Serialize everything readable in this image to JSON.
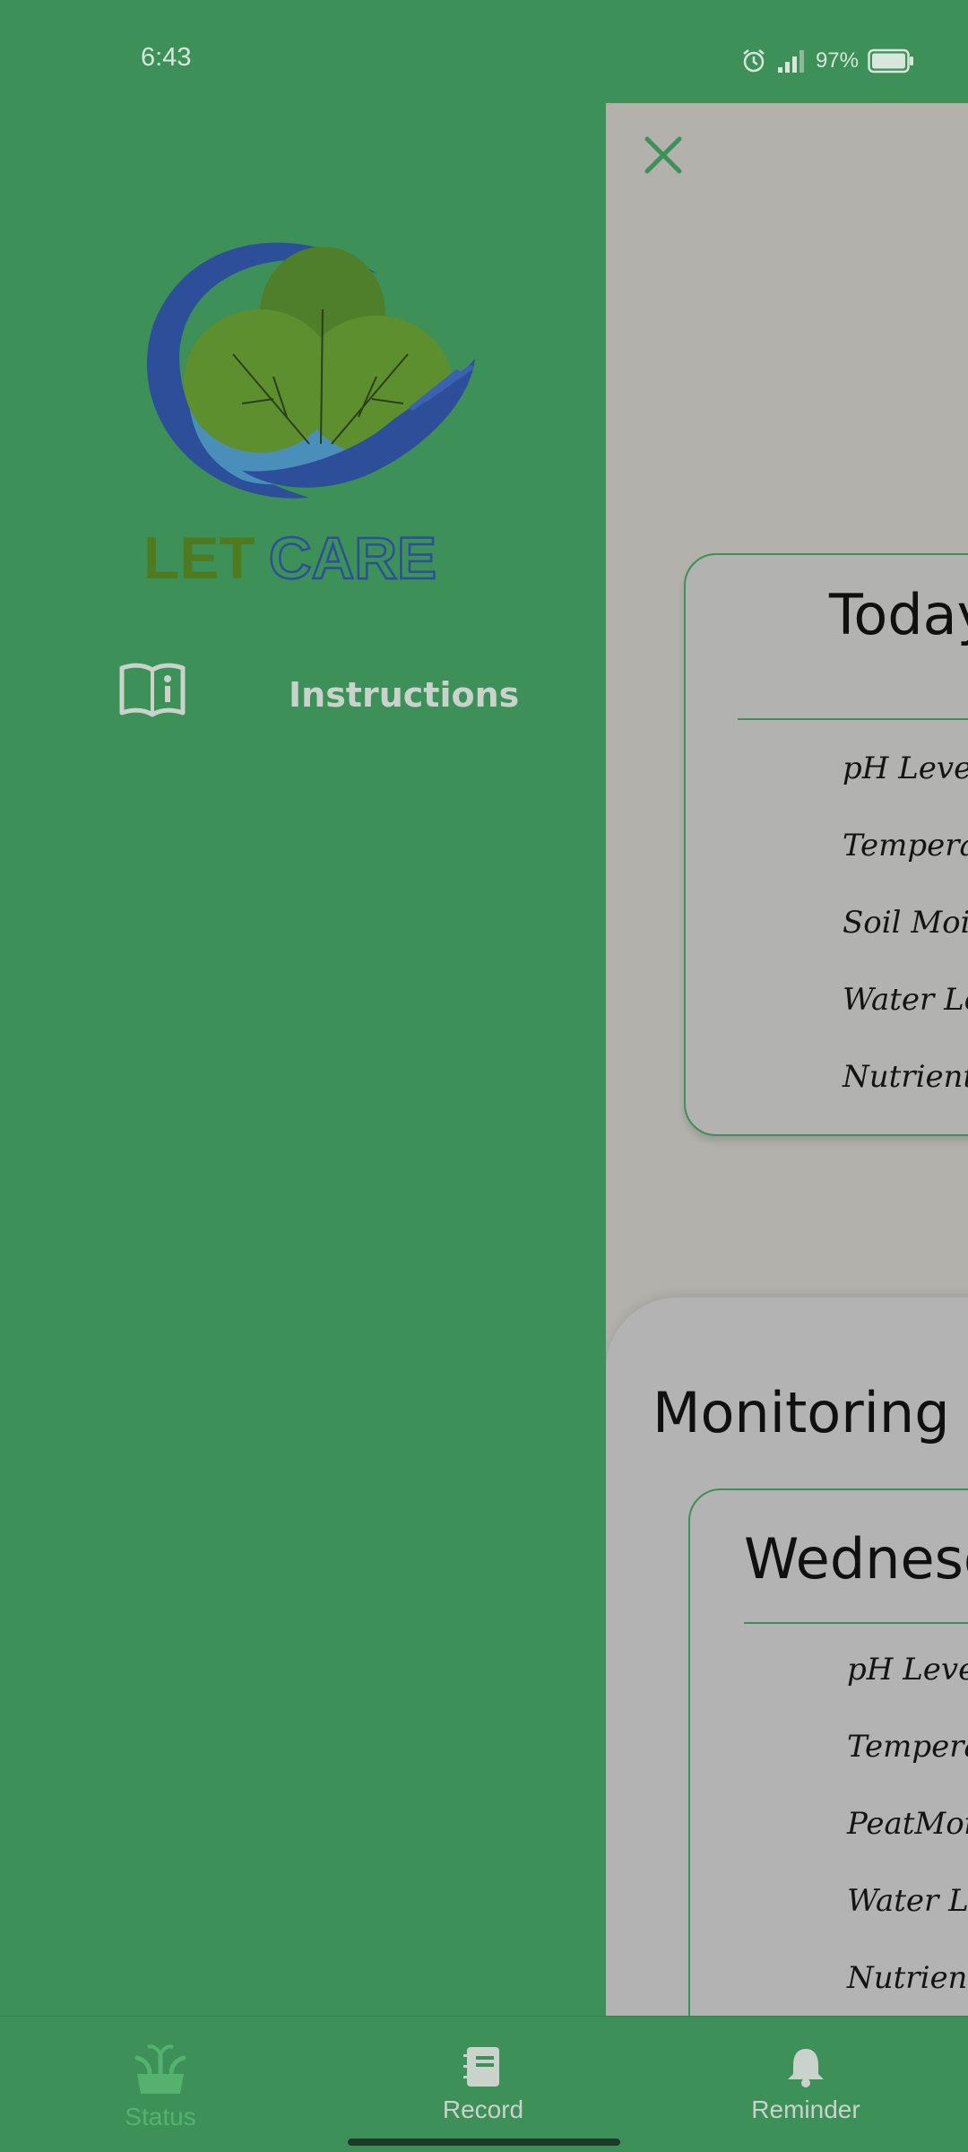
{
  "status_bar": {
    "time": "6:43",
    "battery": "97%",
    "icons": [
      "alarm-icon",
      "signal-icon",
      "battery-icon"
    ]
  },
  "drawer": {
    "logo": {
      "word_left": "LET",
      "word_right": "CARE"
    },
    "instructions_label": "Instructions"
  },
  "main": {
    "today_card": {
      "title": "Today",
      "metrics": [
        "pH Level",
        "Temperature",
        "Soil Moisture",
        "Water Level",
        "Nutrients"
      ]
    },
    "monitoring": {
      "title": "Monitoring Status",
      "weekly_card": {
        "title": "Wednesday",
        "metrics": [
          "pH Level",
          "Temperature",
          "PeatMoisture",
          "Water Level",
          "Nutrients"
        ]
      }
    }
  },
  "bottom_nav": {
    "items": [
      {
        "label": "Status",
        "icon": "sprout-icon",
        "active": true
      },
      {
        "label": "Record",
        "icon": "notebook-icon",
        "active": false
      },
      {
        "label": "Reminder",
        "icon": "bell-icon",
        "active": false
      }
    ]
  },
  "colors": {
    "drawer_bg": "#3c9058",
    "accent_green": "#3c9058",
    "dim_overlay": "#b2b1ac",
    "logo_blue": "#2d4f9a",
    "logo_leaf": "#5e8f2f",
    "status_active": "#55b26e"
  }
}
